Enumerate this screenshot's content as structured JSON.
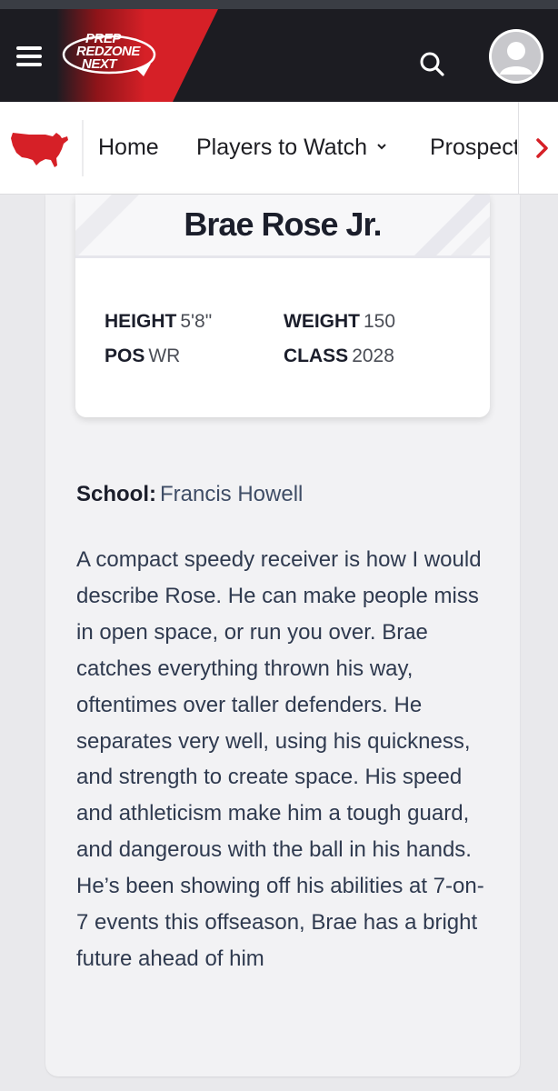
{
  "header": {
    "brand_line1": "PREP",
    "brand_line2": "REDZONE",
    "brand_line3": "NEXT",
    "brand_color": "#d62027"
  },
  "nav": {
    "items": [
      {
        "label": "Home"
      },
      {
        "label": "Players to Watch",
        "chevron": "⌄"
      },
      {
        "label": "Prospect"
      }
    ],
    "scroll_icon": "chevron-right-icon"
  },
  "player": {
    "name": "Brae Rose Jr.",
    "height_label": "HEIGHT",
    "height_value": "5'8\"",
    "weight_label": "WEIGHT",
    "weight_value": "150",
    "pos_label": "POS",
    "pos_value": "WR",
    "class_label": "CLASS",
    "class_value": "2028",
    "school_label": "School:",
    "school_value": "Francis Howell",
    "bio": "A compact speedy receiver is how I would describe Rose. He can make people miss in open space, or run you over. Brae catches everything thrown his way, oftentimes over taller defenders. He separates very well, using his quickness, and strength to create space. His speed and athleticism make him a tough guard, and dangerous with the ball in his hands. He’s been showing off his abilities at 7-on-7 events this offseason, Brae has a bright future ahead of him"
  }
}
